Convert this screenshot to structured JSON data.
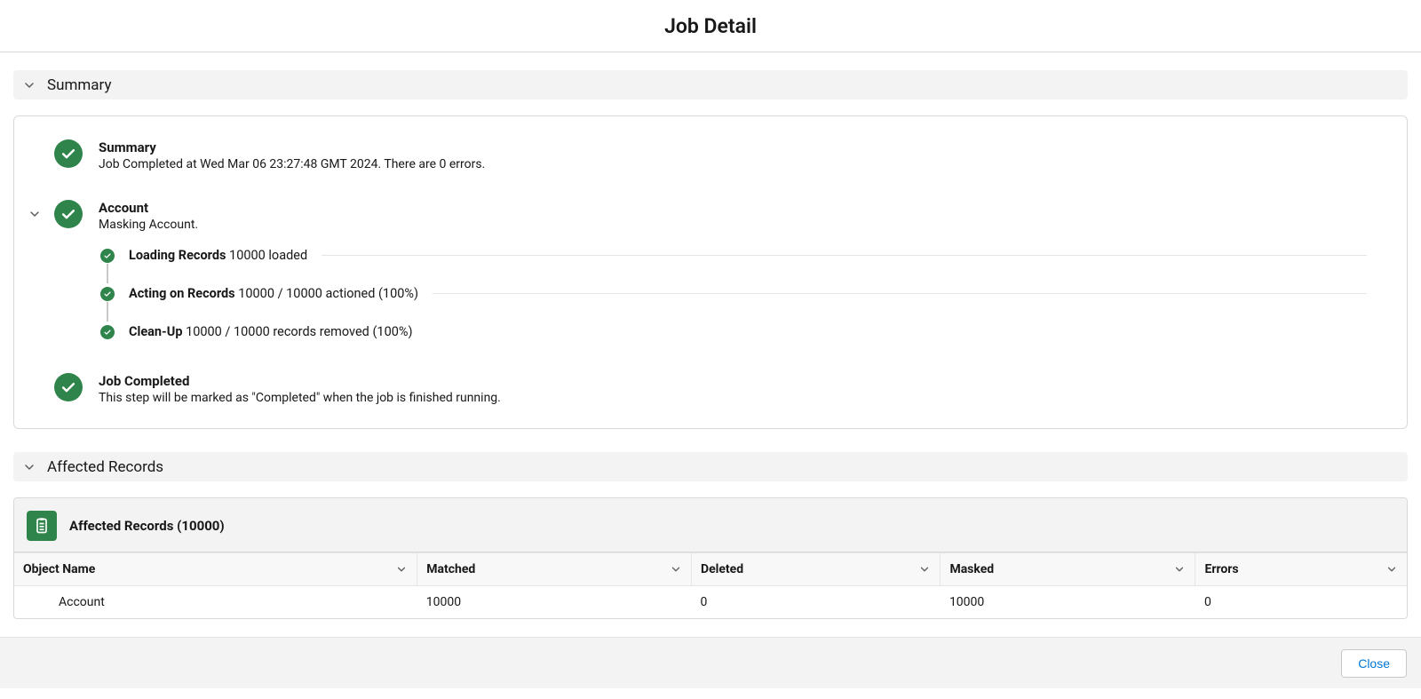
{
  "page_title": "Job Detail",
  "sections": {
    "summary_title": "Summary",
    "affected_title": "Affected Records"
  },
  "summary": {
    "title": "Summary",
    "subtitle": "Job Completed at Wed Mar 06 23:27:48 GMT 2024. There are 0 errors."
  },
  "account": {
    "title": "Account",
    "subtitle": "Masking Account.",
    "steps": [
      {
        "label": "Loading Records",
        "detail": "10000 loaded"
      },
      {
        "label": "Acting on Records",
        "detail": "10000 / 10000 actioned (100%)"
      },
      {
        "label": "Clean-Up",
        "detail": "10000 / 10000 records removed (100%)"
      }
    ]
  },
  "completed": {
    "title": "Job Completed",
    "subtitle": "This step will be marked as \"Completed\" when the job is finished running."
  },
  "records": {
    "panel_title": "Affected Records (10000)",
    "columns": [
      "Object Name",
      "Matched",
      "Deleted",
      "Masked",
      "Errors"
    ],
    "rows": [
      {
        "object": "Account",
        "matched": "10000",
        "deleted": "0",
        "masked": "10000",
        "errors": "0"
      }
    ]
  },
  "footer": {
    "close": "Close"
  }
}
